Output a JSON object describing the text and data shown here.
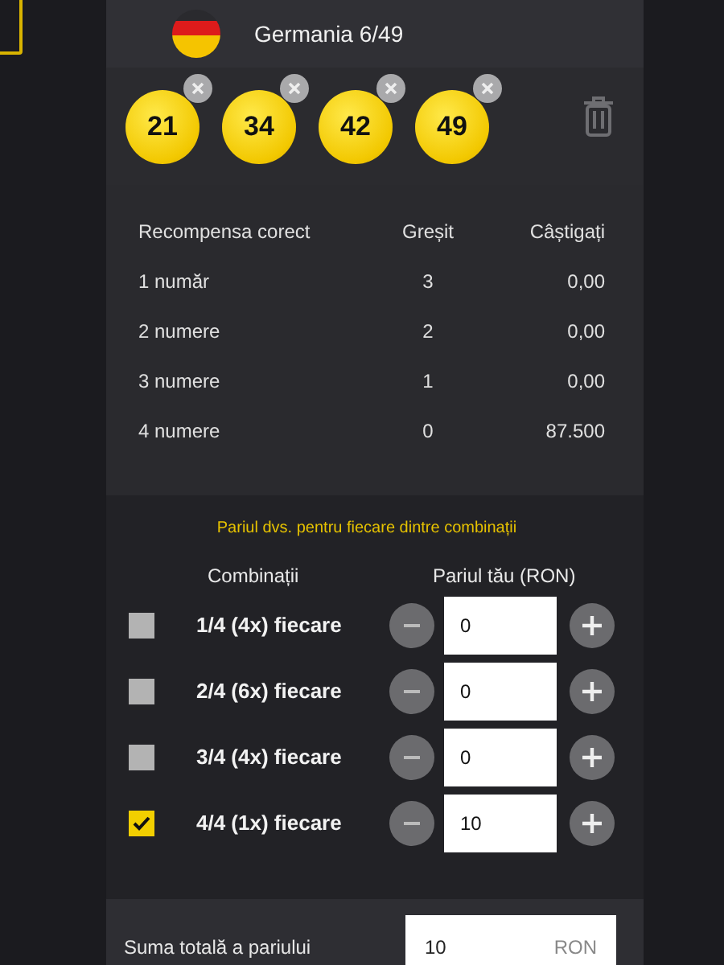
{
  "header": {
    "title": "Germania 6/49"
  },
  "balls": [
    {
      "number": "21"
    },
    {
      "number": "34"
    },
    {
      "number": "42"
    },
    {
      "number": "49"
    }
  ],
  "prize_table": {
    "columns": [
      "Recompensa corect",
      "Greșit",
      "Câștigați"
    ],
    "rows": [
      {
        "matched": "1 număr",
        "wrong": "3",
        "winnings": "0,00"
      },
      {
        "matched": "2 numere",
        "wrong": "2",
        "winnings": "0,00"
      },
      {
        "matched": "3 numere",
        "wrong": "1",
        "winnings": "0,00"
      },
      {
        "matched": "4 numere",
        "wrong": "0",
        "winnings": "87.500"
      }
    ]
  },
  "combinations": {
    "note": "Pariul dvs. pentru fiecare dintre combinații",
    "columns": [
      "Combinații",
      "Pariul tău (RON)"
    ],
    "rows": [
      {
        "label": "1/4 (4x) fiecare",
        "checked": false,
        "stake": "0"
      },
      {
        "label": "2/4 (6x) fiecare",
        "checked": false,
        "stake": "0"
      },
      {
        "label": "3/4 (4x) fiecare",
        "checked": false,
        "stake": "0"
      },
      {
        "label": "4/4 (1x) fiecare",
        "checked": true,
        "stake": "10"
      }
    ]
  },
  "total": {
    "label": "Suma totală a pariului",
    "value": "10",
    "currency": "RON"
  }
}
